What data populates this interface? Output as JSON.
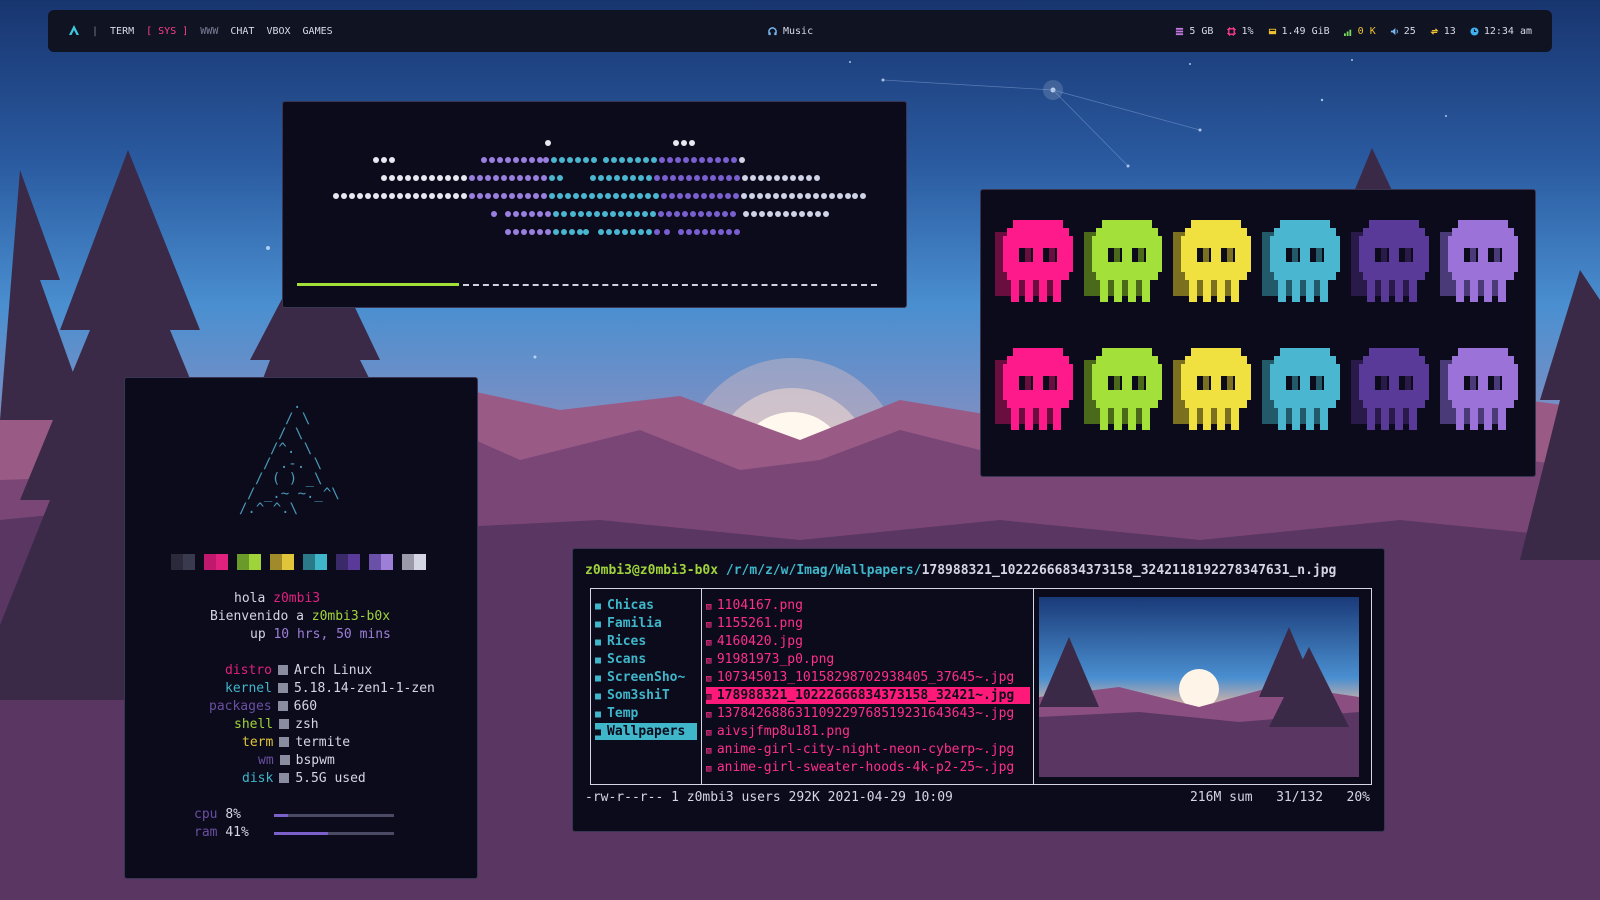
{
  "topbar": {
    "logo_icon": "arch-logo-icon",
    "separator": "|",
    "workspaces": [
      {
        "label": "TERM",
        "state": "normal"
      },
      {
        "label": "[ SYS ]",
        "state": "active"
      },
      {
        "label": "WWW",
        "state": "dim"
      },
      {
        "label": "CHAT",
        "state": "normal"
      },
      {
        "label": "VBOX",
        "state": "normal"
      },
      {
        "label": "GAMES",
        "state": "normal"
      }
    ],
    "music_label": "Music",
    "stats": {
      "memory": "5 GB",
      "cpu": "1%",
      "disk": "1.49 GiB",
      "network": "0 K",
      "volume": "25",
      "updates": "13",
      "clock": "12:34 am"
    },
    "colors": {
      "accent": "#ff3d8b",
      "network": "#f0c030"
    }
  },
  "fetch": {
    "greeting_prefix": "hola",
    "user": "z0mbi3",
    "welcome_prefix": "Bienvenido a",
    "host": "z0mbi3-b0x",
    "uptime_prefix": "up",
    "uptime": "10 hrs, 50 mins",
    "info": [
      {
        "key": "distro",
        "value": "Arch Linux"
      },
      {
        "key": "kernel",
        "value": "5.18.14-zen1-1-zen"
      },
      {
        "key": "packages",
        "value": "660"
      },
      {
        "key": "shell",
        "value": "zsh"
      },
      {
        "key": "term",
        "value": "termite"
      },
      {
        "key": "wm",
        "value": "bspwm"
      },
      {
        "key": "disk",
        "value": "5.5G used"
      }
    ],
    "cpu_label": "cpu",
    "cpu_value": "8%",
    "cpu_fraction": 0.12,
    "ram_label": "ram",
    "ram_value": "41%",
    "ram_fraction": 0.45
  },
  "ranger": {
    "prompt_user": "z0mbi3@z0mbi3-b0x",
    "path_dir": "/r/m/z/w/Imag/Wallpapers/",
    "path_file": "178988321_10222666834373158_3242118192278347631_n.jpg",
    "folders": [
      "Chicas",
      "Familia",
      "Rices",
      "Scans",
      "ScreenSho~",
      "Som3shiT",
      "Temp",
      "Wallpapers"
    ],
    "selected_folder": 7,
    "files": [
      "1104167.png",
      "1155261.png",
      "4160420.jpg",
      "91981973_p0.png",
      "107345013_10158298702938405_37645~.jpg",
      "178988321_10222666834373158_32421~.jpg",
      "137842688631109229768519231643643~.jpg",
      "aivsjfmp8u181.png",
      "anime-girl-city-night-neon-cyberp~.jpg",
      "anime-girl-sweater-hoods-4k-p2-25~.jpg"
    ],
    "selected_file": 5,
    "footer_left": "-rw-r--r-- 1 z0mbi3 users 292K 2021-04-29 10:09",
    "footer_right": "216M sum   31/132   20%"
  },
  "visualizer": {
    "progress_fraction": 0.28,
    "colors": {
      "progress": "#a4e03a"
    }
  },
  "skulls": {
    "colors": [
      "#ff1a8c",
      "#a4e03a",
      "#f0e040",
      "#4ab6d0",
      "#5a3a98",
      "#9a72d8"
    ]
  }
}
